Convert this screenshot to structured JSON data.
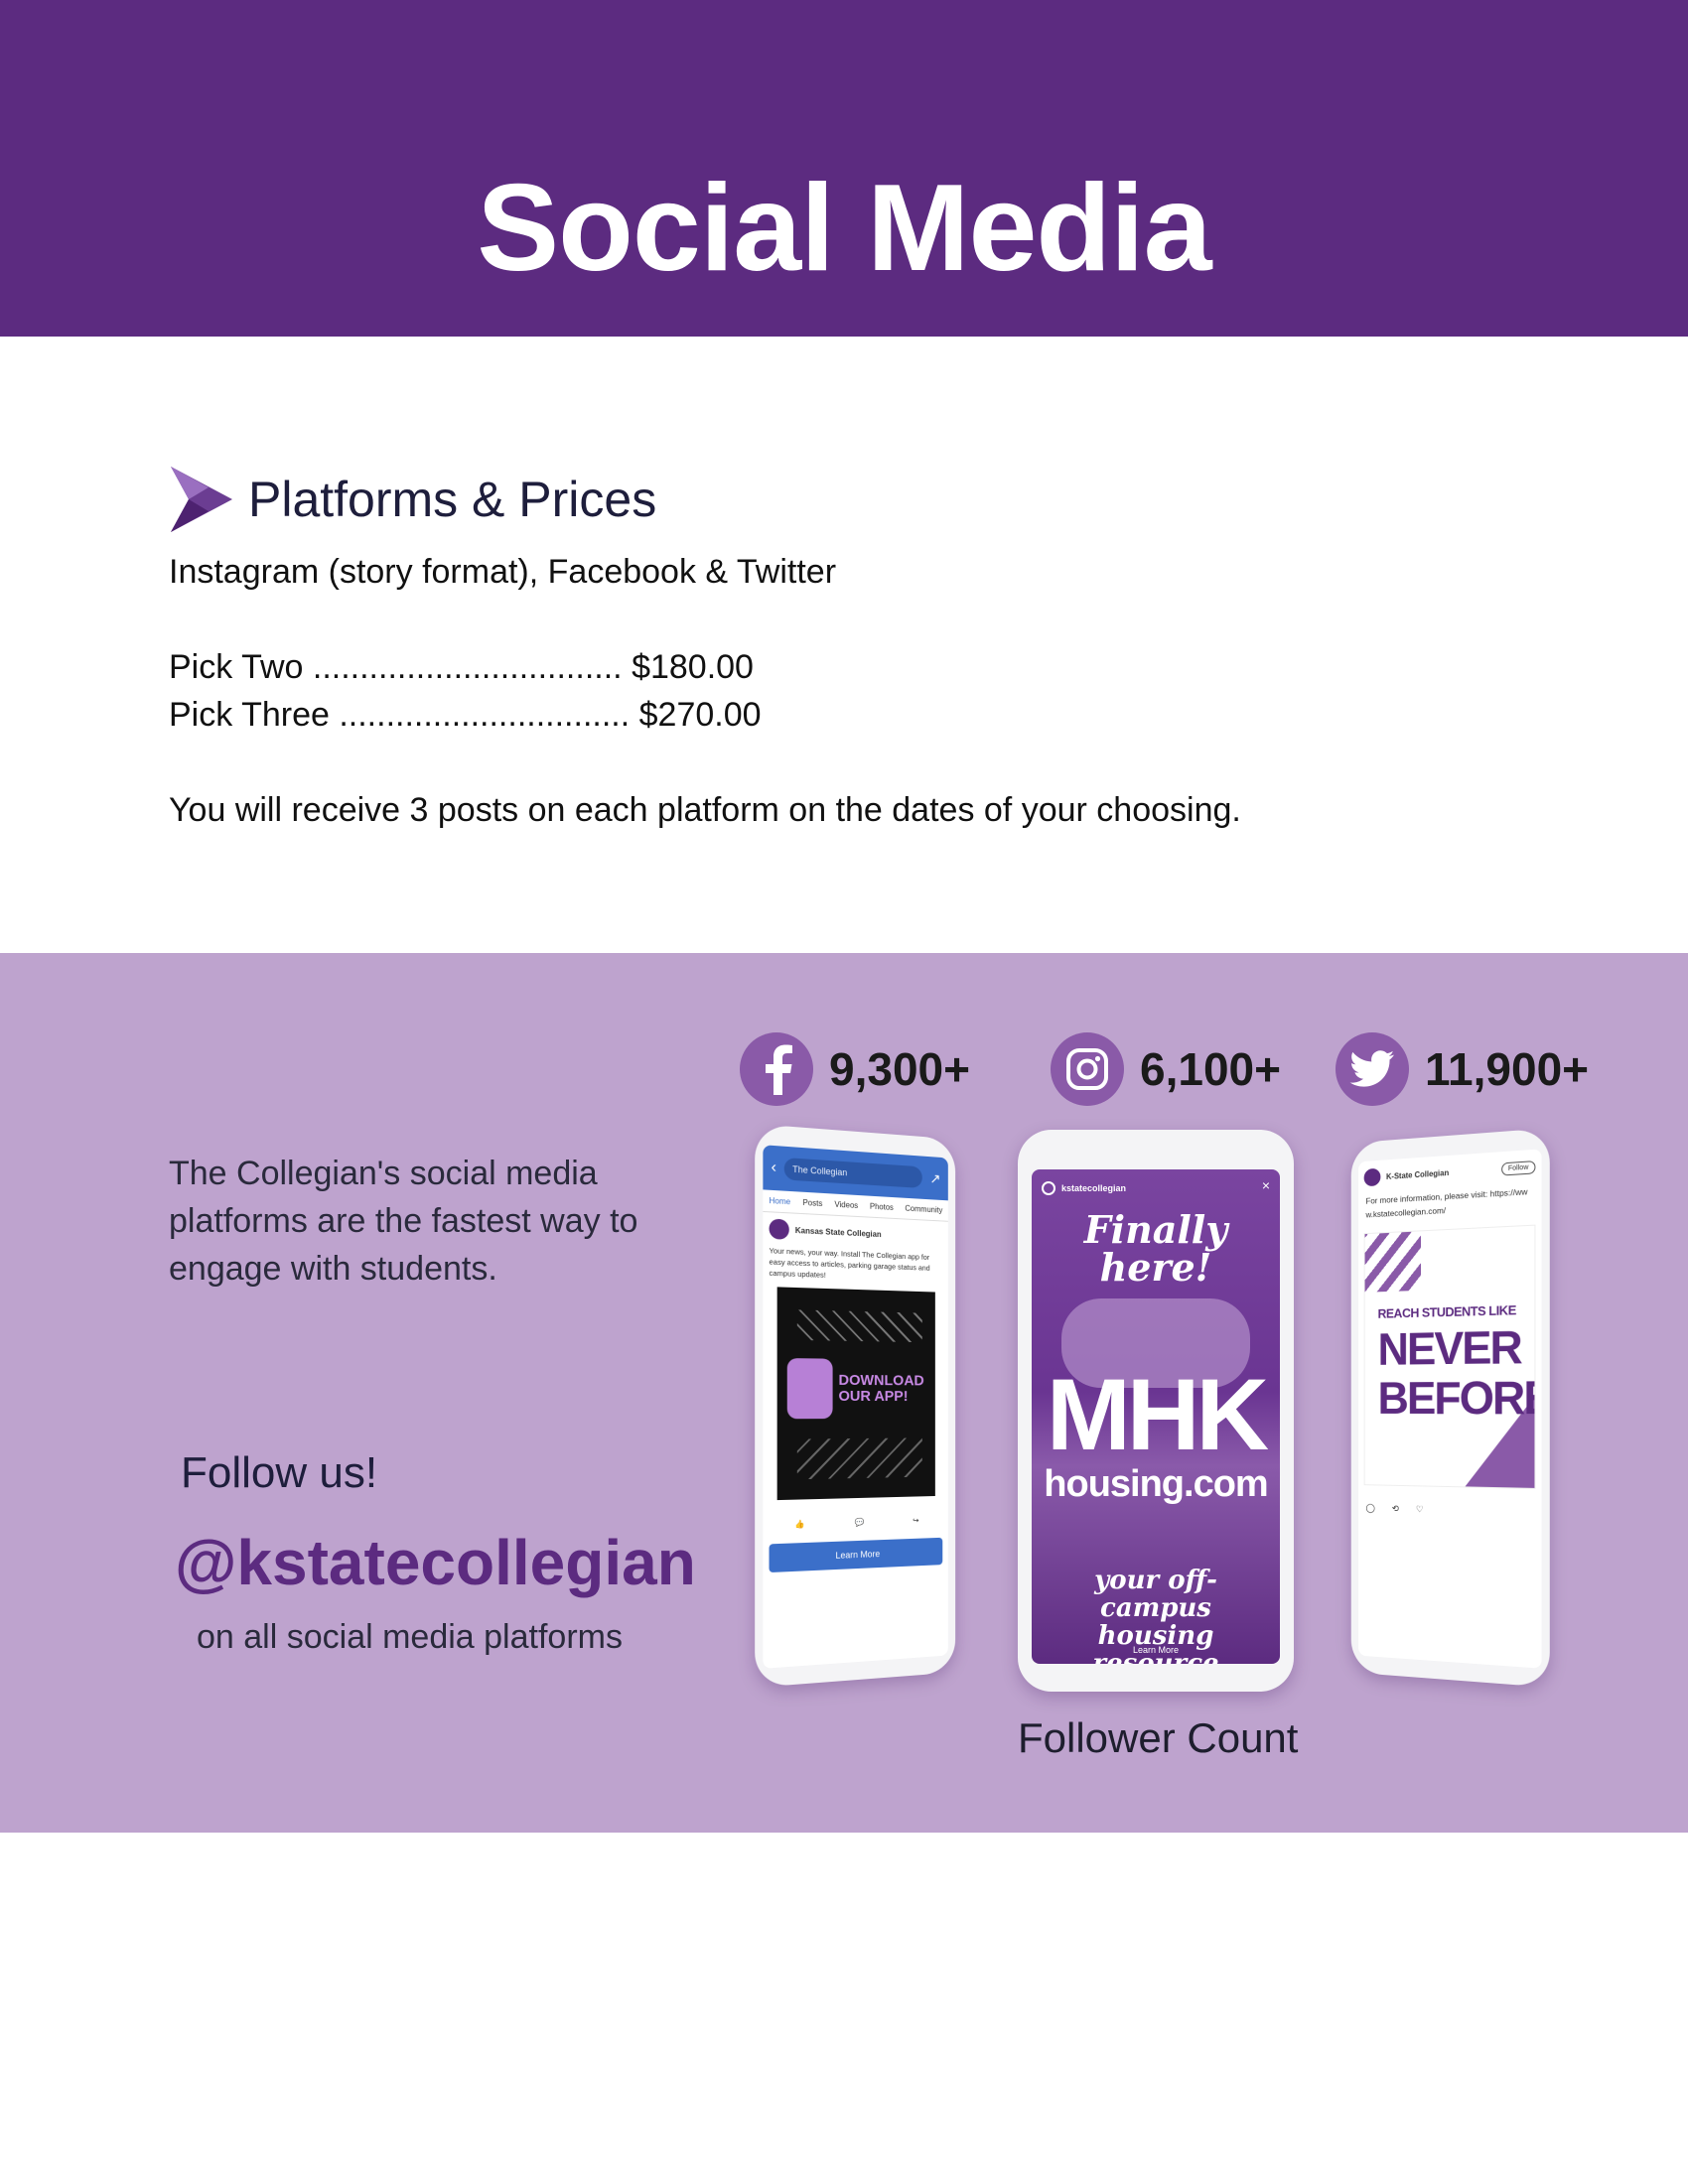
{
  "header": {
    "title": "Social Media"
  },
  "platforms": {
    "heading": "Platforms & Prices",
    "subtitle": "Instagram (story format), Facebook & Twitter",
    "prices": [
      {
        "label": "Pick Two",
        "dots": ".................................",
        "price": "$180.00"
      },
      {
        "label": "Pick Three",
        "dots": "...............................",
        "price": "$270.00"
      }
    ],
    "note": "You will receive 3 posts on each platform on the dates of your choosing."
  },
  "social": {
    "intro": "The Collegian's social media platforms are the fastest way to engage with students.",
    "follow_label": "Follow us!",
    "handle": "@kstatecollegian",
    "handle_sub": "on all social media platforms",
    "stats": [
      {
        "platform": "facebook",
        "icon": "facebook-icon",
        "count": "9,300+"
      },
      {
        "platform": "instagram",
        "icon": "instagram-icon",
        "count": "6,100+"
      },
      {
        "platform": "twitter",
        "icon": "twitter-icon",
        "count": "11,900+"
      }
    ],
    "caption": "Follower Count",
    "mockups": {
      "facebook": {
        "search": "The Collegian",
        "tabs": [
          "Home",
          "Posts",
          "Videos",
          "Photos",
          "Community"
        ],
        "page_name": "Kansas State Collegian",
        "post_text": "Your news, your way. Install The Collegian app for easy access to articles, parking garage status and campus updates!",
        "ad_headline": "DOWNLOAD OUR APP!",
        "cta": "Learn More"
      },
      "instagram": {
        "account": "kstatecollegian",
        "headline": "Finally here!",
        "brand_big": "MHK",
        "brand_small": "housing.com",
        "tagline": "your off-campus housing resource",
        "cta": "Learn More"
      },
      "twitter": {
        "account": "K-State Collegian",
        "follow": "Follow",
        "text": "For more information, please visit: https://www.kstatecollegian.com/",
        "ad_line1": "REACH STUDENTS LIKE",
        "ad_line2": "NEVER",
        "ad_line3": "BEFORE"
      }
    }
  },
  "colors": {
    "brand_purple": "#5c2b80",
    "band_lavender": "#bea3ce",
    "icon_purple": "#8a5aa8"
  }
}
